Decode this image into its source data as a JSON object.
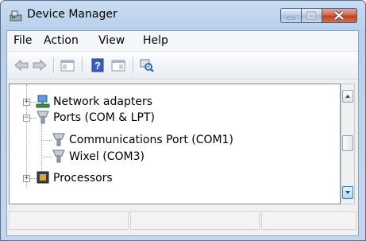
{
  "window": {
    "title": "Device Manager",
    "title_icon": "device-manager-icon"
  },
  "menu": {
    "items": [
      "File",
      "Action",
      "View",
      "Help"
    ]
  },
  "toolbar": {
    "buttons": [
      "back-arrow-icon",
      "forward-arrow-icon",
      "show-hide-console-tree-icon",
      "help-icon",
      "properties-pane-icon",
      "scan-hardware-icon"
    ]
  },
  "tree": {
    "items": [
      {
        "label": "Network adapters",
        "icon": "network-adapter-icon",
        "expanded": false
      },
      {
        "label": "Ports (COM & LPT)",
        "icon": "port-connector-icon",
        "expanded": true
      },
      {
        "label": "Communications Port (COM1)",
        "icon": "port-connector-icon"
      },
      {
        "label": "Wixel (COM3)",
        "icon": "port-connector-icon"
      },
      {
        "label": "Processors",
        "icon": "processor-chip-icon",
        "expanded": false
      }
    ]
  },
  "colors": {
    "title_gradient": "#c3d8f0",
    "close_button": "#c0401f",
    "selection": "#3c7fb1"
  }
}
